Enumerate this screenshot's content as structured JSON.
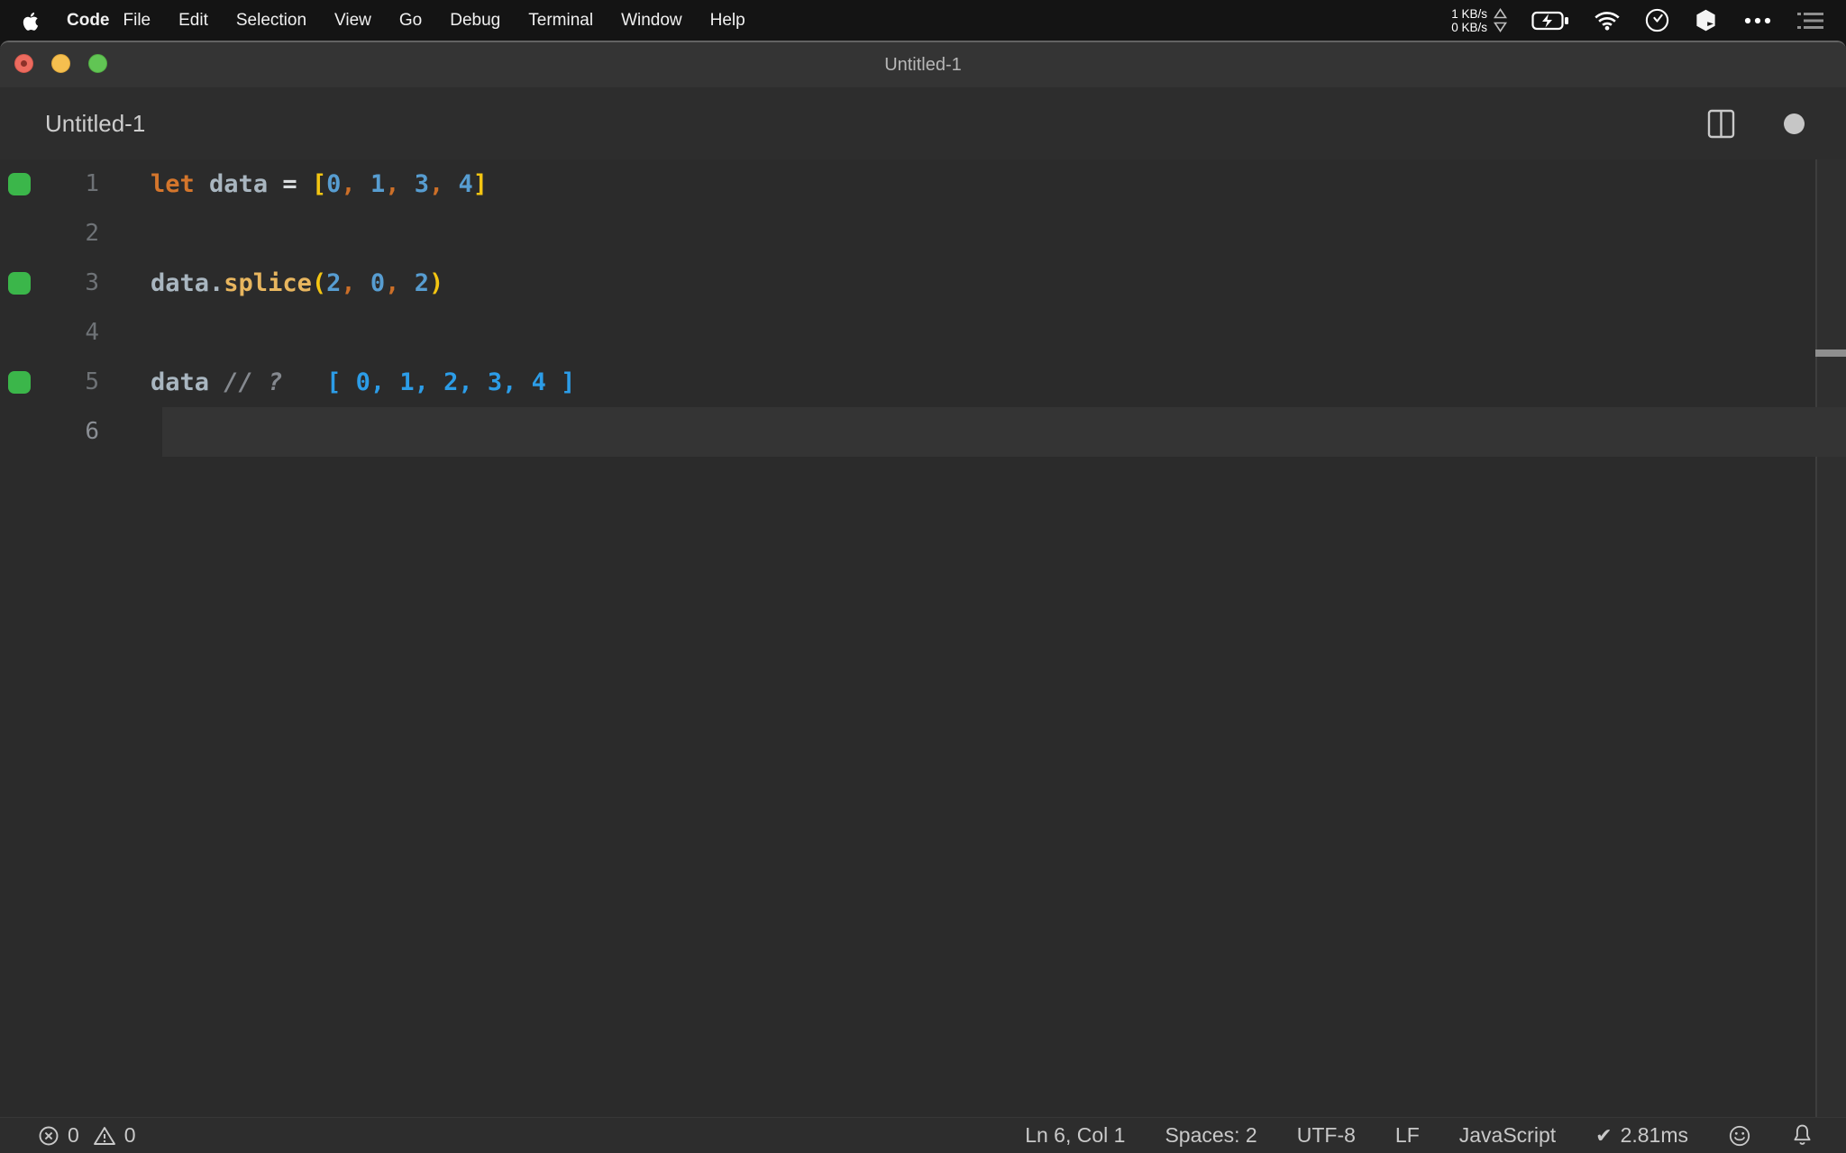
{
  "colors": {
    "keyword": "#d4762c",
    "identifier": "#a9b6c0",
    "operator": "#d9dcde",
    "bracket": "#f3c512",
    "number": "#579dd1",
    "comma": "#cc6f28",
    "function": "#e8b65f",
    "comment": "#85898f",
    "quokka_value": "#2c9de8",
    "coverage_green": "#3bb64a"
  },
  "menu_bar": {
    "app_menu": "Code",
    "items": [
      "File",
      "Edit",
      "Selection",
      "View",
      "Go",
      "Debug",
      "Terminal",
      "Window",
      "Help"
    ],
    "network_up": "1 KB/s",
    "network_down": "0 KB/s",
    "status_icons": [
      "network-speed",
      "battery-charging",
      "wifi",
      "clock",
      "cube-app",
      "more-dots",
      "list-menu"
    ]
  },
  "window": {
    "title": "Untitled-1",
    "controls": [
      "close",
      "minimize",
      "zoom"
    ]
  },
  "editor_header": {
    "tab_label": "Untitled-1"
  },
  "editor": {
    "language": "javascript",
    "lines": [
      {
        "number": "1",
        "coverage": true,
        "current": false,
        "tokens": [
          [
            "let",
            "keyword"
          ],
          [
            " ",
            ""
          ],
          [
            "data",
            "identifier"
          ],
          [
            " ",
            ""
          ],
          [
            "=",
            "operator"
          ],
          [
            " ",
            ""
          ],
          [
            "[",
            "bracket"
          ],
          [
            "0",
            "number"
          ],
          [
            ",",
            "comma"
          ],
          [
            " ",
            ""
          ],
          [
            "1",
            "number"
          ],
          [
            ",",
            "comma"
          ],
          [
            " ",
            ""
          ],
          [
            "3",
            "number"
          ],
          [
            ",",
            "comma"
          ],
          [
            " ",
            ""
          ],
          [
            "4",
            "number"
          ],
          [
            "]",
            "bracket"
          ]
        ]
      },
      {
        "number": "2",
        "coverage": false,
        "current": false,
        "tokens": []
      },
      {
        "number": "3",
        "coverage": true,
        "current": false,
        "tokens": [
          [
            "data",
            "identifier"
          ],
          [
            ".",
            "identifier"
          ],
          [
            "splice",
            "function"
          ],
          [
            "(",
            "bracket"
          ],
          [
            "2",
            "number"
          ],
          [
            ",",
            "comma"
          ],
          [
            " ",
            ""
          ],
          [
            "0",
            "number"
          ],
          [
            ",",
            "comma"
          ],
          [
            " ",
            ""
          ],
          [
            "2",
            "number"
          ],
          [
            ")",
            "bracket"
          ]
        ]
      },
      {
        "number": "4",
        "coverage": false,
        "current": false,
        "tokens": []
      },
      {
        "number": "5",
        "coverage": true,
        "current": false,
        "tokens": [
          [
            "data",
            "identifier"
          ],
          [
            " ",
            ""
          ],
          [
            "// ?",
            "comment"
          ],
          [
            "   [ 0, 1, 2, 3, 4 ]",
            "quokka_value"
          ]
        ]
      },
      {
        "number": "6",
        "coverage": false,
        "current": true,
        "tokens": []
      }
    ]
  },
  "status_bar": {
    "errors": "0",
    "warnings": "0",
    "cursor_position": "Ln 6, Col 1",
    "indentation": "Spaces: 2",
    "encoding": "UTF-8",
    "eol": "LF",
    "language_mode": "JavaScript",
    "quokka_check": "✔",
    "quokka_time": "2.81ms"
  }
}
